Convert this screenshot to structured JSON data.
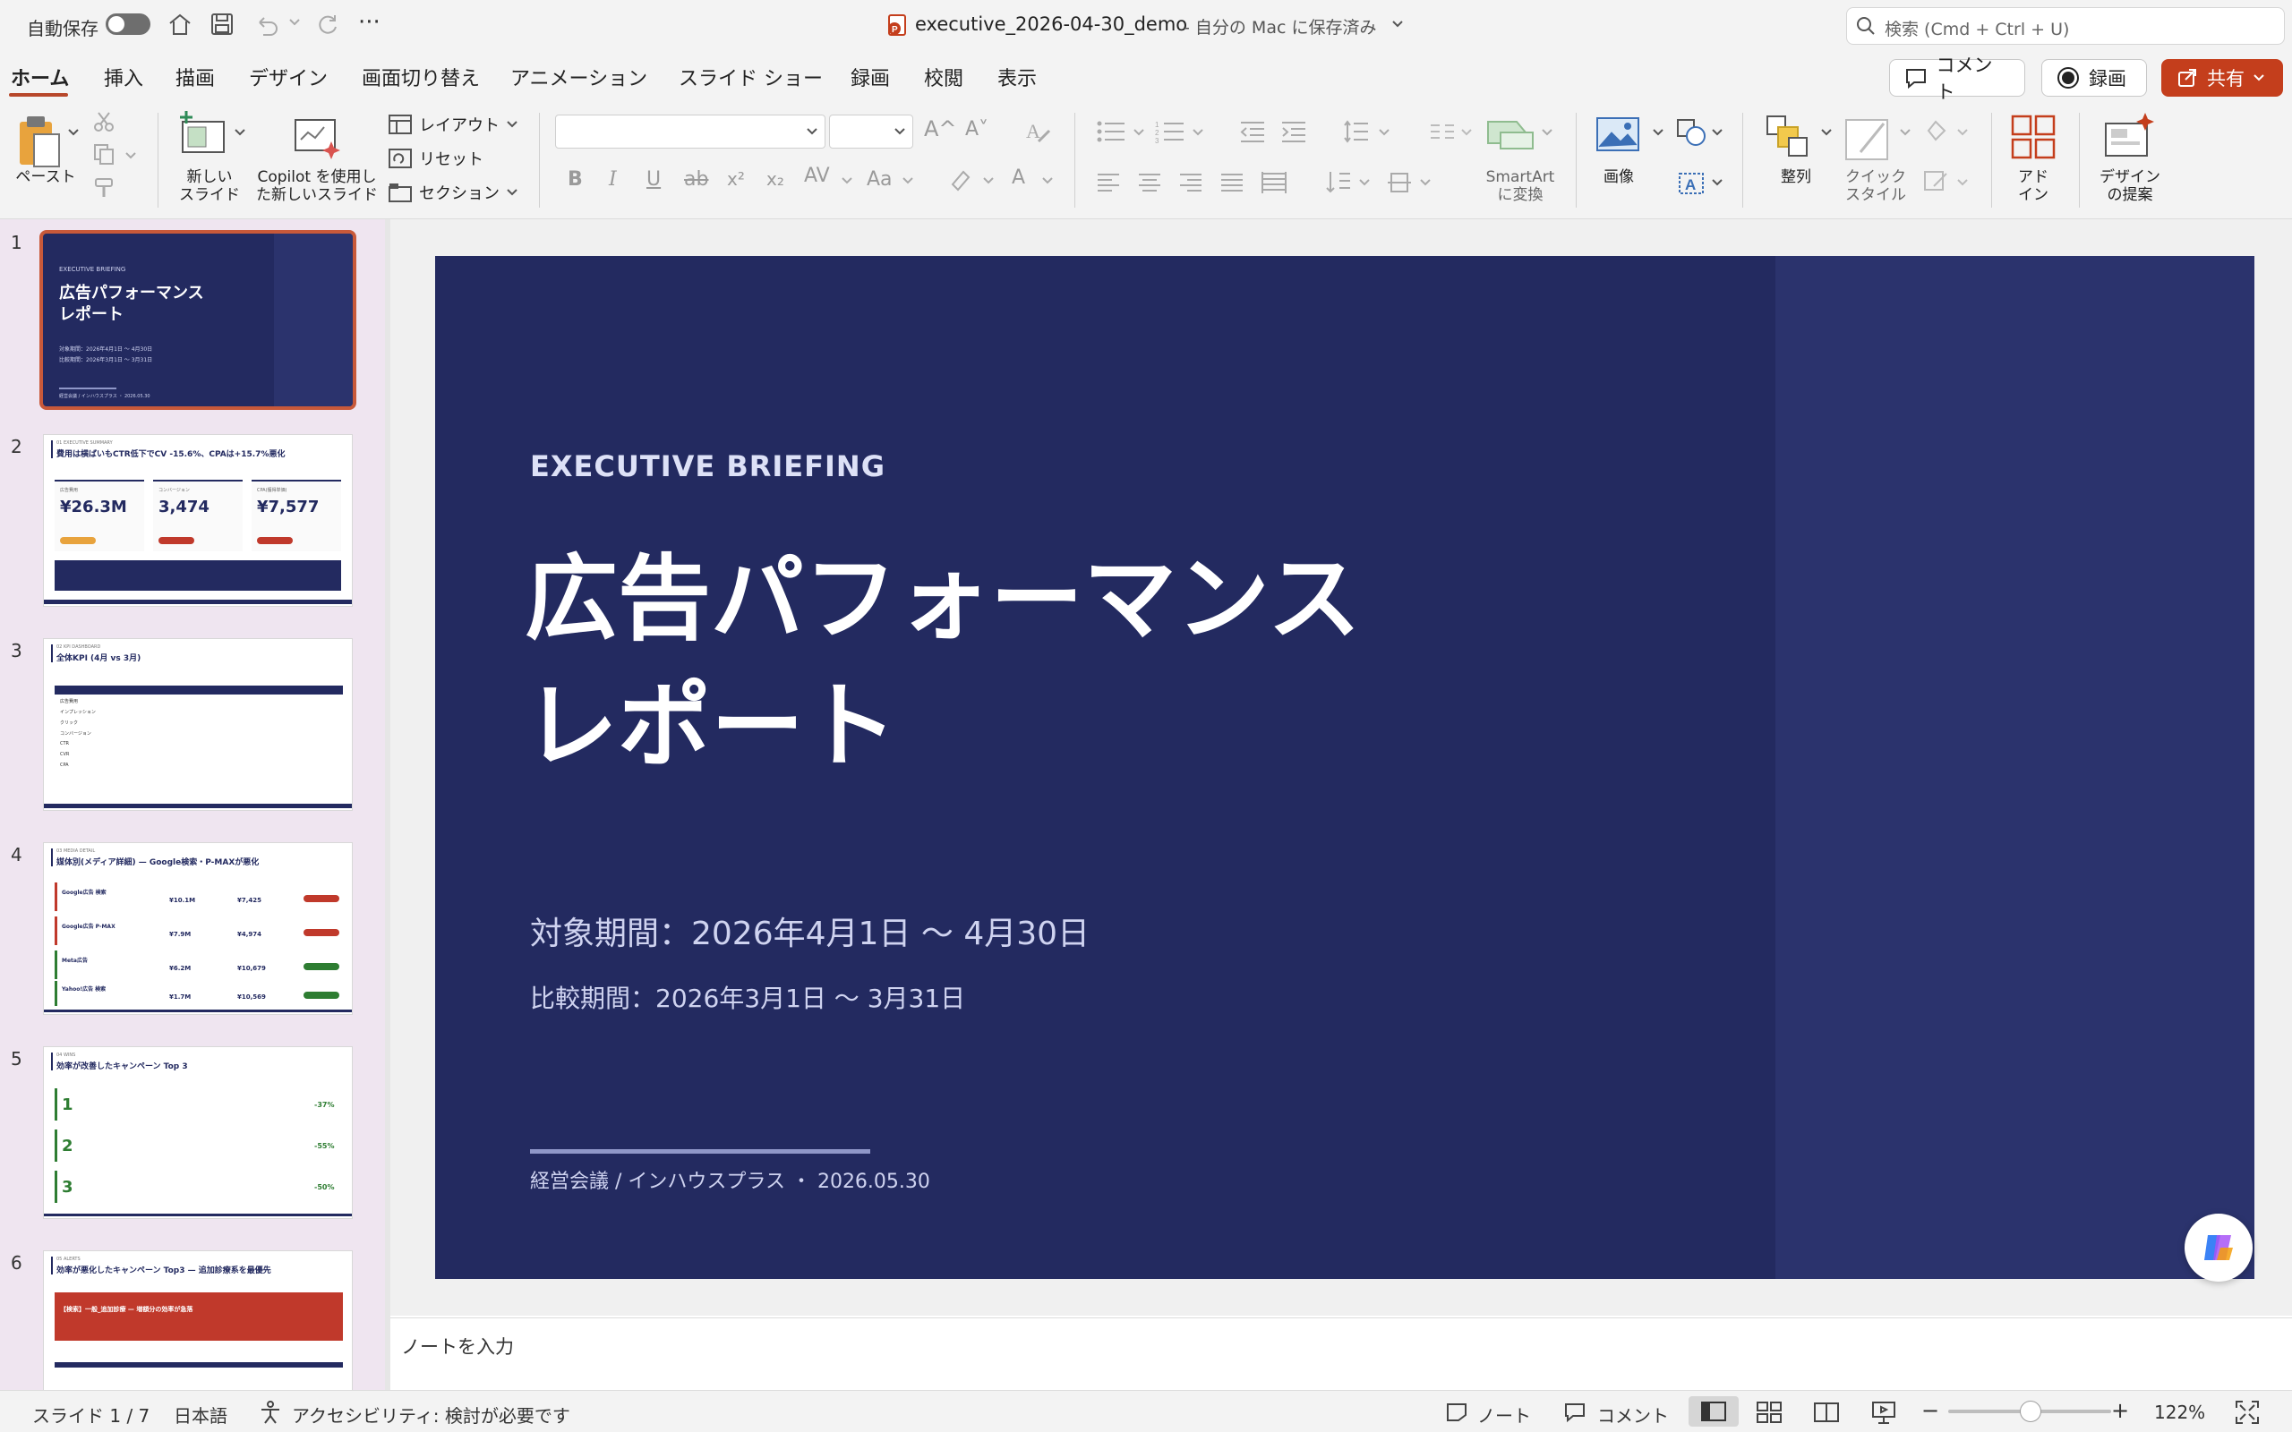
{
  "titlebar": {
    "autosave_label": "自動保存",
    "file_name": "executive_2026-04-30_demo",
    "save_status": "- 自分の Mac に保存済み",
    "search_placeholder": "検索 (Cmd + Ctrl + U)"
  },
  "tabs": [
    {
      "label": "ホーム"
    },
    {
      "label": "挿入"
    },
    {
      "label": "描画"
    },
    {
      "label": "デザイン"
    },
    {
      "label": "画面切り替え"
    },
    {
      "label": "アニメーション"
    },
    {
      "label": "スライド ショー"
    },
    {
      "label": "録画"
    },
    {
      "label": "校閲"
    },
    {
      "label": "表示"
    }
  ],
  "actions": {
    "comment": "コメント",
    "record": "録画",
    "share": "共有"
  },
  "ribbon": {
    "paste": "ペースト",
    "new_slide_1": "新しい",
    "new_slide_2": "スライド",
    "copilot_1": "Copilot を使用し",
    "copilot_2": "た新しいスライド",
    "layout": "レイアウト",
    "reset": "リセット",
    "section": "セクション",
    "smartart_1": "SmartArt",
    "smartart_2": "に変換",
    "image": "画像",
    "arrange": "整列",
    "quick_style_1": "クイック",
    "quick_style_2": "スタイル",
    "addin_1": "アド",
    "addin_2": "イン",
    "design_1": "デザイン",
    "design_2": "の提案",
    "font_grow": "A^",
    "font_shrink": "A˅"
  },
  "slide": {
    "kicker": "EXECUTIVE BRIEFING",
    "title_line1": "広告パフォーマンス",
    "title_line2": "レポート",
    "period": "対象期間：2026年4月1日 〜 4月30日",
    "compare": "比較期間：2026年3月1日 〜 3月31日",
    "footer": "経営会議 / インハウスプラス ・ 2026.05.30"
  },
  "thumbnails": [
    {
      "num": "1",
      "kicker": "EXECUTIVE BRIEFING",
      "title1": "広告パフォーマンス",
      "title2": "レポート",
      "line1": "対象期間：2026年4月1日 〜 4月30日",
      "line2": "比較期間：2026年3月1日 〜 3月31日",
      "footer": "経営会議 / インハウスプラス ・ 2026.05.30"
    },
    {
      "num": "2",
      "kicker": "01 EXECUTIVE SUMMARY",
      "title": "費用は横ばいもCTR低下でCV -15.6%、CPAは+15.7%悪化",
      "kpis": [
        {
          "label": "広告費用",
          "value": "¥26.3M"
        },
        {
          "label": "コンバージョン",
          "value": "3,474"
        },
        {
          "label": "CPA(獲得単価)",
          "value": "¥7,577"
        }
      ]
    },
    {
      "num": "3",
      "kicker": "02 KPI DASHBOARD",
      "title": "全体KPI (4月 vs 3月)",
      "rows": [
        "広告費用",
        "インプレッション",
        "クリック",
        "コンバージョン",
        "CTR",
        "CVR",
        "CPA"
      ]
    },
    {
      "num": "4",
      "kicker": "03 MEDIA DETAIL",
      "title": "媒体別(メディア詳細) — Google検索・P-MAXが悪化",
      "rows": [
        {
          "name": "Google広告 検索",
          "v1": "¥10.1M",
          "v2": "¥7,425"
        },
        {
          "name": "Google広告 P-MAX",
          "v1": "¥7.9M",
          "v2": "¥4,974"
        },
        {
          "name": "Meta広告",
          "v1": "¥6.2M",
          "v2": "¥10,679"
        },
        {
          "name": "Yahoo!広告 検索",
          "v1": "¥1.7M",
          "v2": "¥10,569"
        }
      ]
    },
    {
      "num": "5",
      "kicker": "04 WINS",
      "title": "効率が改善したキャンペーン Top 3",
      "items": [
        {
          "rank": "1",
          "change": "-37%"
        },
        {
          "rank": "2",
          "change": "-55%"
        },
        {
          "rank": "3",
          "change": "-50%"
        }
      ]
    },
    {
      "num": "6",
      "kicker": "05 ALERTS",
      "title": "効率が悪化したキャンペーン Top3 — 追加診療系を最優先",
      "banner": "【検索】一般_追加診療 — 増額分の効率が急落"
    }
  ],
  "notes_placeholder": "ノートを入力",
  "status": {
    "slide_counter": "スライド 1 / 7",
    "language": "日本語",
    "accessibility": "アクセシビリティ: 検討が必要です",
    "notes": "ノート",
    "comments": "コメント",
    "zoom": "122%",
    "zoom_fraction": 0.5
  }
}
